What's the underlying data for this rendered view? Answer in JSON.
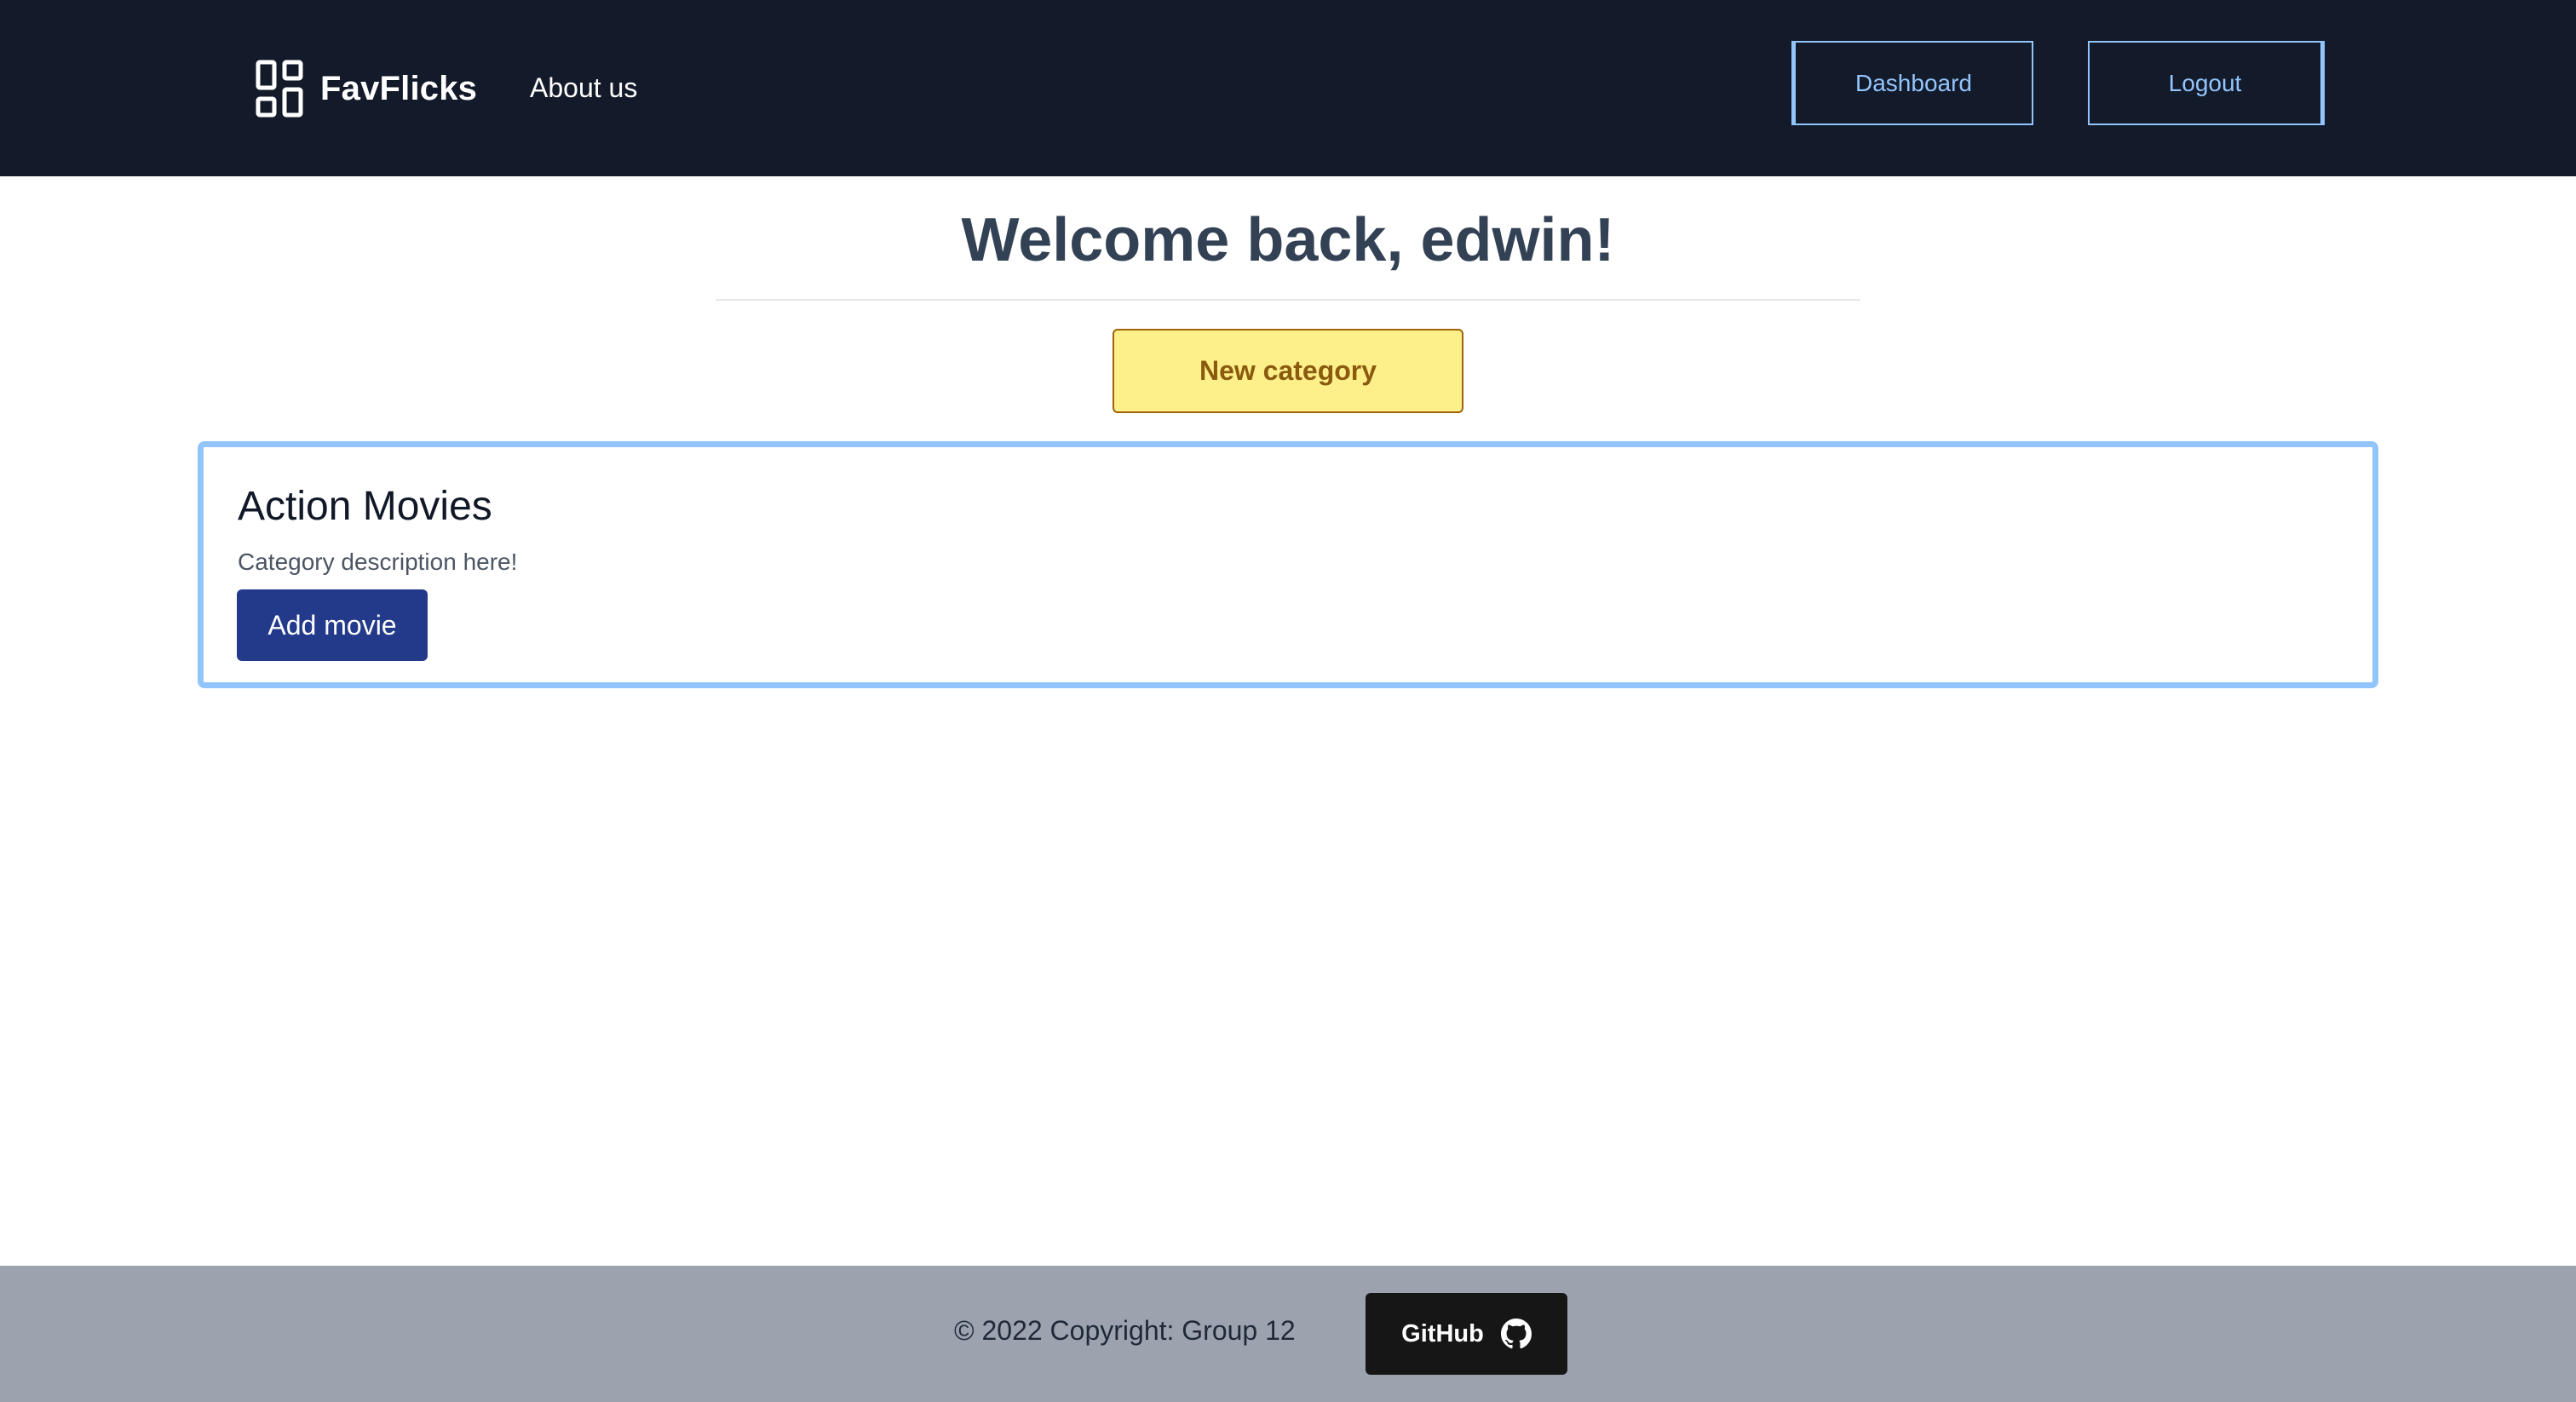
{
  "navbar": {
    "brand": {
      "logo_icon": "dashboard-grid-icon",
      "name": "FavFlicks"
    },
    "links": {
      "about": "About us"
    },
    "buttons": {
      "dashboard": "Dashboard",
      "logout": "Logout"
    }
  },
  "main": {
    "welcome": "Welcome back, edwin!",
    "new_category_label": "New category",
    "categories": [
      {
        "title": "Action Movies",
        "description": "Category description here!",
        "add_movie_label": "Add movie"
      }
    ]
  },
  "footer": {
    "copyright": "© 2022 Copyright: Group 12",
    "github_label": "GitHub",
    "github_icon": "github-icon"
  },
  "colors": {
    "navbar_bg": "#131a2a",
    "nav_button_accent": "#93c5fd",
    "new_category_bg": "#fdf08a",
    "new_category_text": "#8a5a0e",
    "card_border": "#93c5fd",
    "add_movie_bg": "#233a8a",
    "footer_bg": "#9ca3af",
    "github_bg": "#161616"
  }
}
